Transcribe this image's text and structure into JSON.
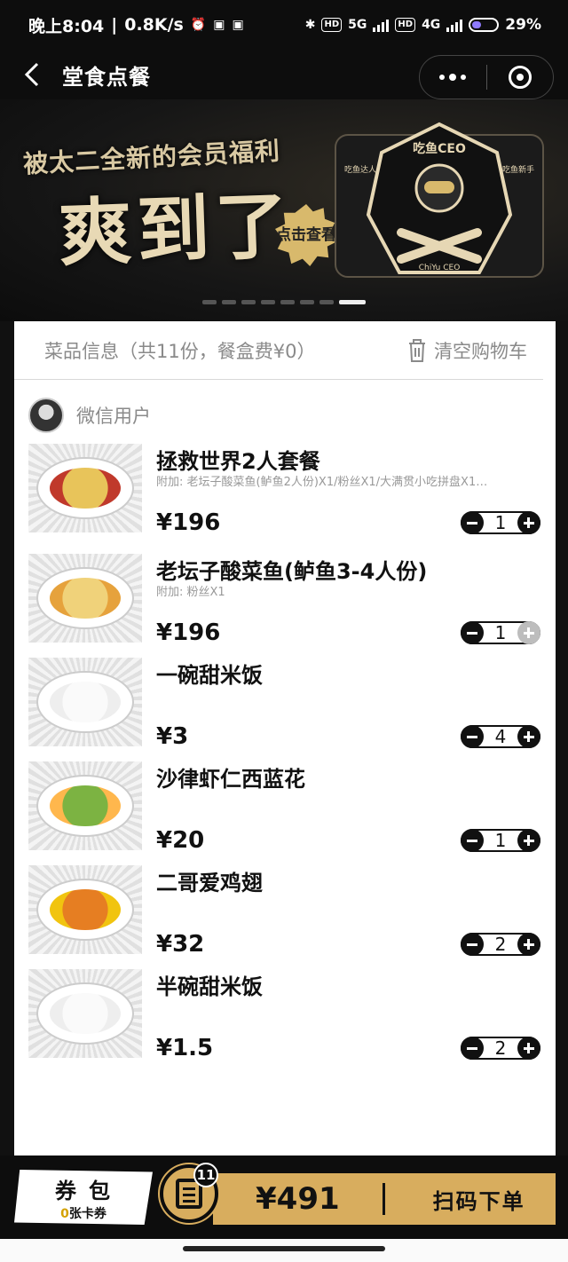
{
  "status_bar": {
    "time": "晚上8:04",
    "net_speed": "0.8K/s",
    "battery": "29%",
    "network_labels": [
      "5G",
      "4G"
    ],
    "hd_label": "HD"
  },
  "nav": {
    "title": "堂食点餐"
  },
  "banner": {
    "line1": "被太二全新的会员福利",
    "line2": "爽到了",
    "tag": "点击查看",
    "mascot_title": "吃鱼CEO",
    "mascot_sub": "ChiYu CEO",
    "badge_left": "吃鱼达人",
    "badge_right": "吃鱼新手",
    "slide_count": 8,
    "active_slide": 7
  },
  "cart": {
    "summary": "菜品信息（共11份，餐盒费¥0）",
    "clear_label": "清空购物车",
    "user_name": "微信用户",
    "items": [
      {
        "name": "拯救世界2人套餐",
        "extra": "附加: 老坛子酸菜鱼(鲈鱼2人份)X1/粉丝X1/大满贯小吃拼盘X1…",
        "price": "¥196",
        "qty": "1",
        "plus_disabled": false
      },
      {
        "name": "老坛子酸菜鱼(鲈鱼3-4人份)",
        "extra": "附加: 粉丝X1",
        "price": "¥196",
        "qty": "1",
        "plus_disabled": true
      },
      {
        "name": "一碗甜米饭",
        "extra": "",
        "price": "¥3",
        "qty": "4",
        "plus_disabled": false
      },
      {
        "name": "沙律虾仁西蓝花",
        "extra": "",
        "price": "¥20",
        "qty": "1",
        "plus_disabled": false
      },
      {
        "name": "二哥爱鸡翅",
        "extra": "",
        "price": "¥32",
        "qty": "2",
        "plus_disabled": false
      },
      {
        "name": "半碗甜米饭",
        "extra": "",
        "price": "¥1.5",
        "qty": "2",
        "plus_disabled": false
      }
    ]
  },
  "bottom": {
    "coupon_title": "券包",
    "coupon_count": "0",
    "coupon_unit": "张卡券",
    "cart_badge": "11",
    "total": "¥491",
    "order_label": "扫码下单"
  },
  "colors": {
    "accent": "#d8ad5e",
    "dark": "#0d0d0d",
    "muted": "#8a8a8a",
    "coupon_count": "#d4a100"
  }
}
